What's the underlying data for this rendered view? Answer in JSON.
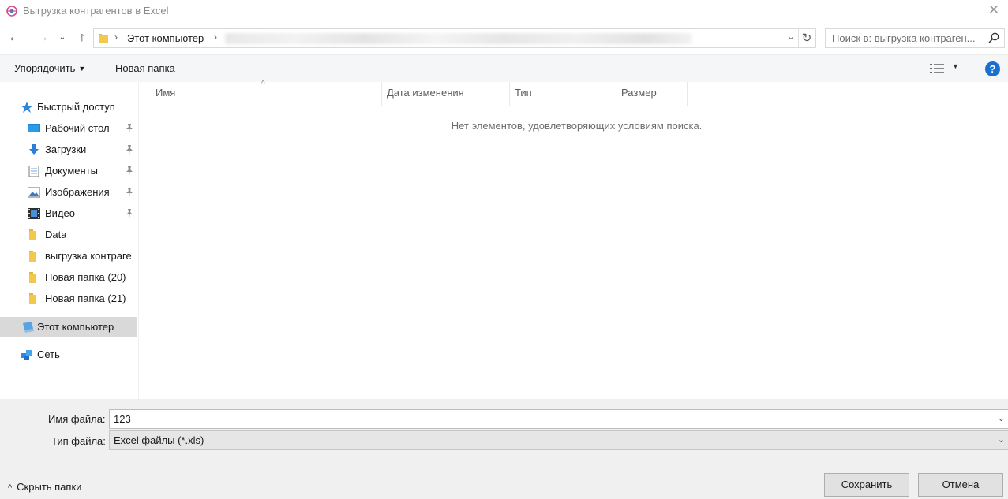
{
  "window": {
    "title": "Выгрузка контрагентов в Excel",
    "close_glyph": "✕"
  },
  "navigation": {
    "back_glyph": "←",
    "forward_glyph": "→",
    "recent_glyph": "⌄",
    "up_glyph": "↑"
  },
  "address": {
    "crumb": "Этот компьютер",
    "separator_glyph": "›",
    "dropdown_glyph": "⌄",
    "refresh_glyph": "↻"
  },
  "search": {
    "placeholder": "Поиск в: выгрузка контраген..."
  },
  "toolbar": {
    "organize_label": "Упорядочить",
    "organize_caret": "▼",
    "new_folder_label": "Новая папка",
    "view_caret": "▼",
    "help_glyph": "?"
  },
  "sidebar": {
    "items": [
      {
        "label": "Быстрый доступ",
        "icon": "star-icon"
      },
      {
        "label": "Рабочий стол",
        "icon": "desktop-icon",
        "pinned": true
      },
      {
        "label": "Загрузки",
        "icon": "downloads-icon",
        "pinned": true
      },
      {
        "label": "Документы",
        "icon": "documents-icon",
        "pinned": true
      },
      {
        "label": "Изображения",
        "icon": "pictures-icon",
        "pinned": true
      },
      {
        "label": "Видео",
        "icon": "video-icon",
        "pinned": true
      },
      {
        "label": "Data",
        "icon": "folder-icon"
      },
      {
        "label": "выгрузка контраге",
        "icon": "folder-icon"
      },
      {
        "label": "Новая папка (20)",
        "icon": "folder-icon"
      },
      {
        "label": "Новая папка (21)",
        "icon": "folder-icon"
      },
      {
        "label": "Этот компьютер",
        "icon": "computer-icon",
        "selected": true
      },
      {
        "label": "Сеть",
        "icon": "network-icon"
      }
    ]
  },
  "file_list": {
    "columns": [
      "Имя",
      "Дата изменения",
      "Тип",
      "Размер"
    ],
    "sort_glyph": "^",
    "empty_message": "Нет элементов, удовлетворяющих условиям поиска."
  },
  "form": {
    "filename_label": "Имя файла:",
    "filename_value": "123",
    "filetype_label": "Тип файла:",
    "filetype_value": "Excel файлы (*.xls)",
    "chevron_glyph": "⌄"
  },
  "footer": {
    "hide_folders_glyph": "^",
    "hide_folders_label": "Скрыть папки",
    "save_label": "Сохранить",
    "cancel_label": "Отмена"
  },
  "colors": {
    "accent": "#1a6fd1",
    "folder": "#f2c94c",
    "selected_item": "#d9d9d9",
    "bottom_panel": "#f0f0f0"
  }
}
